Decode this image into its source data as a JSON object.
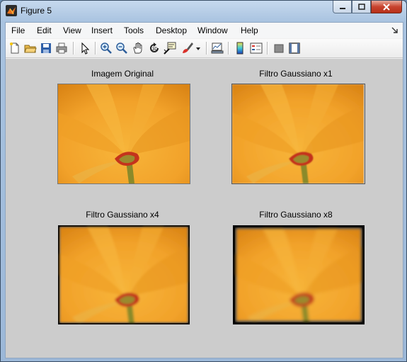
{
  "window": {
    "title": "Figure 5"
  },
  "menu": [
    "File",
    "Edit",
    "View",
    "Insert",
    "Tools",
    "Desktop",
    "Window",
    "Help"
  ],
  "toolbar": {
    "tools": [
      "new-figure",
      "open-file",
      "save",
      "print",
      "edit-plot",
      "zoom-in",
      "zoom-out",
      "pan",
      "rotate-3d",
      "data-cursor",
      "brush",
      "insert-colorbar",
      "insert-legend",
      "hide-plot-tools",
      "show-plot-tools"
    ]
  },
  "axes": [
    {
      "title": "Imagem Original",
      "border": "thin"
    },
    {
      "title": "Filtro Gaussiano x1",
      "border": "thin"
    },
    {
      "title": "Filtro Gaussiano x4",
      "border": "medium"
    },
    {
      "title": "Filtro Gaussiano x8",
      "border": "thick"
    }
  ],
  "colors": {
    "figure_bg": "#cccccc",
    "petal": "#f2a22a",
    "stem": "#8a8a2a",
    "center": "#c4331c"
  }
}
